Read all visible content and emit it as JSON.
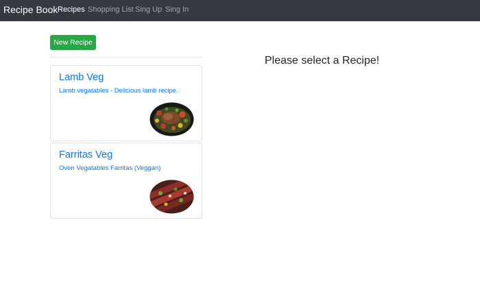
{
  "navbar": {
    "brand": "Recipe Book",
    "links": [
      {
        "label": "Recipes",
        "active": true
      },
      {
        "label": "Shopping List",
        "active": false
      },
      {
        "label": "Sing Up",
        "active": false
      },
      {
        "label": "Sing In",
        "active": false
      }
    ]
  },
  "actions": {
    "new_recipe_label": "New Recipe"
  },
  "recipes": [
    {
      "name": "Lamb Veg",
      "description": "Lamb vegatables - Delicious lamb recipe.",
      "image": "lamb-dish-image"
    },
    {
      "name": "Farritas Veg",
      "description": "Oven Vegatables Farritas (Veggan)",
      "image": "farritas-dish-image"
    }
  ],
  "detail": {
    "placeholder": "Please select a Recipe!"
  },
  "colors": {
    "navbar_bg": "#343a40",
    "button_green": "#28a745",
    "link_blue": "#007bff",
    "card_border": "#dee2e6"
  }
}
